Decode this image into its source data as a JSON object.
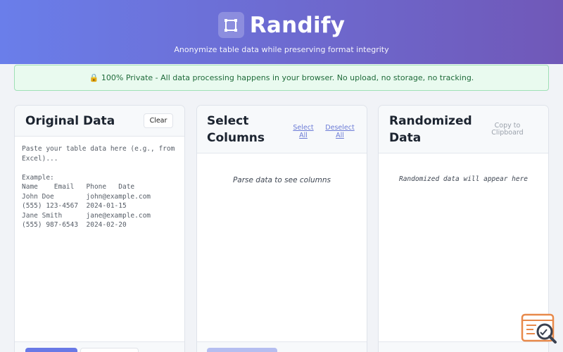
{
  "header": {
    "title": "Randify",
    "subtitle": "Anonymize table data while preserving format integrity",
    "logo_icon": "bounding-box-icon",
    "gradient": [
      "#6a7eea",
      "#7058b8"
    ]
  },
  "privacy_banner": {
    "icon": "lock-icon",
    "text": "🔒 100% Private - All data processing happens in your browser. No upload, no storage, no tracking."
  },
  "original_panel": {
    "title": "Original Data",
    "clear_label": "Clear",
    "input_value": "",
    "placeholder": "Paste your table data here (e.g., from\nExcel)...\n\nExample:\nName    Email   Phone   Date\nJohn Doe        john@example.com\n(555) 123-4567  2024-01-15\nJane Smith      jane@example.com\n(555) 987-6543  2024-02-20"
  },
  "columns_panel": {
    "title_line1": "Select",
    "title_line2": "Columns",
    "select_all_line1": "Select",
    "select_all_line2": "All",
    "deselect_all_line1": "Deselect",
    "deselect_all_line2": "All",
    "empty_text": "Parse data to see columns"
  },
  "randomized_panel": {
    "title_line1": "Randomized",
    "title_line2": "Data",
    "copy_line1": "Copy to",
    "copy_line2": "Clipboard",
    "empty_text": "Randomized data will appear here"
  },
  "colors": {
    "accent": "#6979e6",
    "privacy_bg": "#e9faef",
    "privacy_text": "#1f6b3a",
    "fab_orange": "#e8894a"
  },
  "floating_widget": {
    "icon": "search-console-icon"
  }
}
